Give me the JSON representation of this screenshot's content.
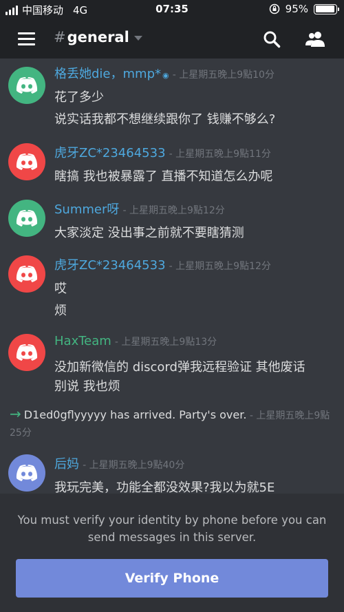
{
  "status_bar": {
    "carrier": "中国移动",
    "network": "4G",
    "time": "07:35",
    "battery": "95%",
    "battery_level": 0.95
  },
  "header": {
    "hash": "#",
    "channel": "general"
  },
  "messages": [
    {
      "username": "格丢她die，mmp*",
      "name_color": "#4ea8de",
      "badge": "◉",
      "timestamp": "上星期五晚上9點10分",
      "avatar_color": "#43b581",
      "lines": [
        "花了多少",
        "说实话我都不想继续跟你了 钱赚不够么?"
      ]
    },
    {
      "username": "虎牙ZC*23464533",
      "name_color": "#4ea8de",
      "timestamp": "上星期五晚上9點11分",
      "avatar_color": "#f04747",
      "lines": [
        "瞎搞 我也被暴露了 直播不知道怎么办呢"
      ]
    },
    {
      "username": "Summer呀",
      "name_color": "#4ea8de",
      "timestamp": "上星期五晚上9點12分",
      "avatar_color": "#43b581",
      "lines": [
        "大家淡定 没出事之前就不要瞎猜测"
      ]
    },
    {
      "username": "虎牙ZC*23464533",
      "name_color": "#4ea8de",
      "timestamp": "上星期五晚上9點12分",
      "avatar_color": "#f04747",
      "lines": [
        "哎",
        "烦"
      ]
    },
    {
      "username": "HaxTeam",
      "name_color": "#43b581",
      "timestamp": "上星期五晚上9點13分",
      "avatar_color": "#f04747",
      "lines": [
        "没加新微信的 discord弹我远程验证 其他废话",
        "别说 我也烦"
      ]
    },
    {
      "username": "后妈",
      "name_color": "#4ea8de",
      "timestamp": "上星期五晚上9點40分",
      "avatar_color": "#7289da",
      "lines": [
        "我玩完美，功能全都没效果?我以为就5E"
      ]
    }
  ],
  "system_message": {
    "arrow": "→",
    "text": "D1ed0gflyyyyy has arrived. Party's over.",
    "timestamp": "上星期五晚上9點25分"
  },
  "verify": {
    "text": "You must verify your identity by phone before you can send messages in this server.",
    "button": "Verify Phone"
  },
  "colors": {
    "background": "#36393f",
    "header": "#202225",
    "accent": "#7289da",
    "green": "#43b581",
    "red": "#f04747"
  }
}
